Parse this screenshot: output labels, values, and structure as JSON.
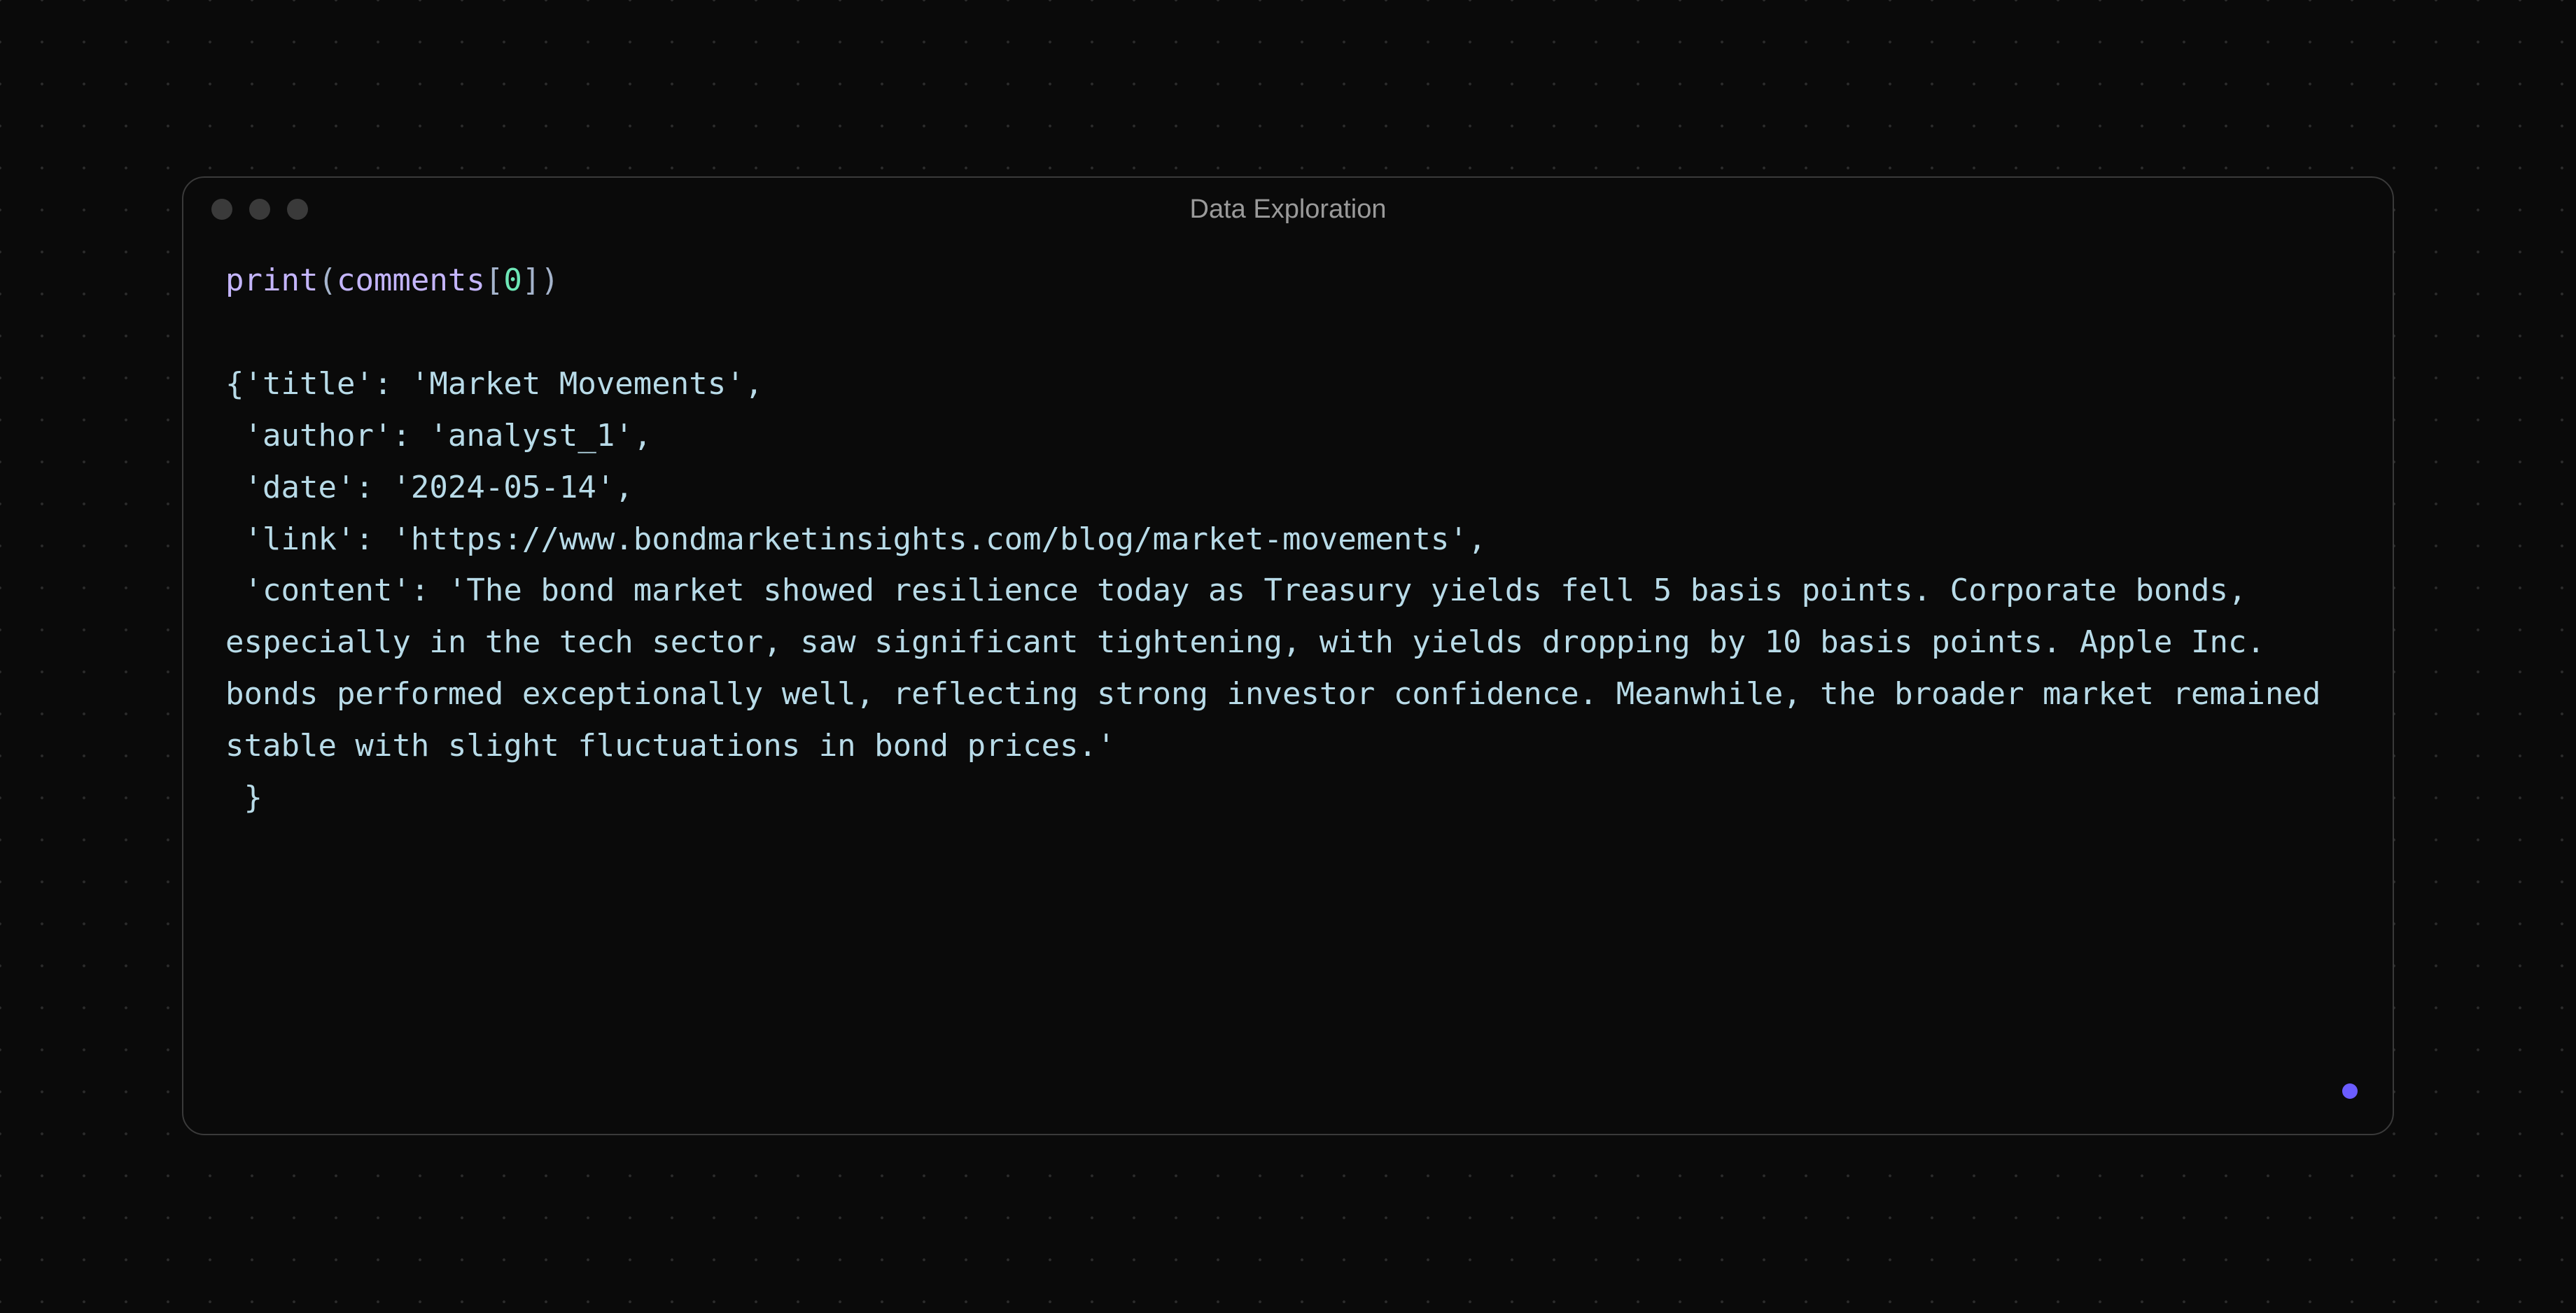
{
  "window": {
    "title": "Data Exploration"
  },
  "input": {
    "fn": "print",
    "open_paren": "(",
    "ident": "comments",
    "open_bracket": "[",
    "index": "0",
    "close_bracket": "]",
    "close_paren": ")"
  },
  "output": {
    "line1": "{'title': 'Market Movements',",
    "line2": " 'author': 'analyst_1',",
    "line3": " 'date': '2024-05-14',",
    "line4": " 'link': 'https://www.bondmarketinsights.com/blog/market-movements',",
    "line5": " 'content': 'The bond market showed resilience today as Treasury yields fell 5 basis points. Corporate bonds, especially in the tech sector, saw significant tightening, with yields dropping by 10 basis points. Apple Inc. bonds performed exceptionally well, reflecting strong investor confidence. Meanwhile, the broader market remained stable with slight fluctuations in bond prices.'",
    "line6": " }"
  },
  "colors": {
    "status_dot": "#6b5cff"
  }
}
